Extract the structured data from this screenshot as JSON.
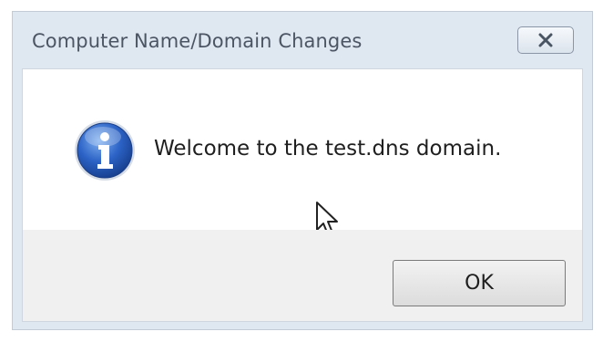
{
  "dialog": {
    "title": "Computer Name/Domain Changes",
    "message": "Welcome to the test.dns domain.",
    "icon": "info-icon",
    "close_icon": "close-icon",
    "ok_label": "OK"
  }
}
